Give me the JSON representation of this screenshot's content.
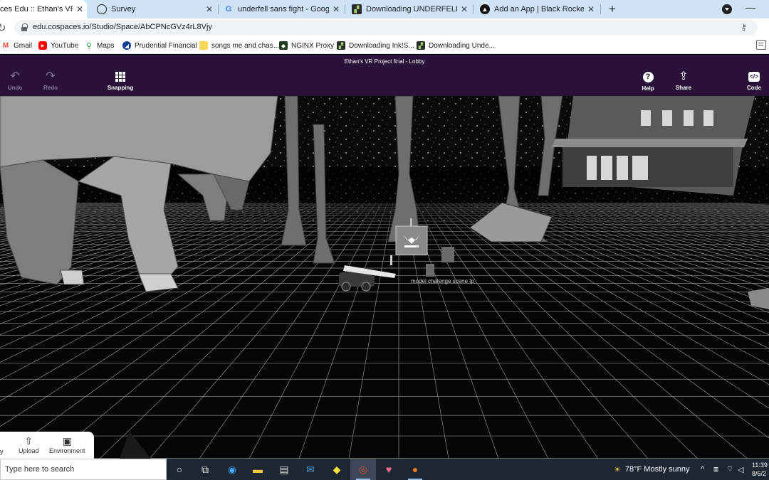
{
  "browser": {
    "tabs": [
      {
        "title": "ces Edu :: Ethan's VR Proje",
        "icon": "cospaces-icon",
        "active": true
      },
      {
        "title": "Survey",
        "icon": "survey-icon",
        "active": false
      },
      {
        "title": "underfell sans fight - Google Sea",
        "icon": "google-icon",
        "active": false
      },
      {
        "title": "Downloading UNDERFELL Sans F",
        "icon": "download-site-icon",
        "active": false
      },
      {
        "title": "Add an App | Black Rocket Arcad",
        "icon": "black-rocket-icon",
        "active": false
      }
    ],
    "close_glyph": "✕",
    "new_tab_glyph": "+",
    "minimize_glyph": "—",
    "url": "edu.cospaces.io/Studio/Space/AbCPNcGVz4rL8Vjy",
    "bookmarks": [
      {
        "label": "Gmail",
        "icon": "gmail-icon",
        "color": "#ea4335"
      },
      {
        "label": "YouTube",
        "icon": "youtube-icon",
        "color": "#ff0000"
      },
      {
        "label": "Maps",
        "icon": "maps-pin-icon",
        "color": "#34a853"
      },
      {
        "label": "Prudential Financial",
        "icon": "prudential-icon",
        "color": "#0b3d91"
      },
      {
        "label": "songs me and chas...",
        "icon": "folder-note-icon",
        "color": "#f9d65c"
      },
      {
        "label": "NGINX Proxy",
        "icon": "nginx-cat-icon",
        "color": "#2f6b2f"
      },
      {
        "label": "Downloading Ink!S...",
        "icon": "download-site-icon",
        "color": "#4a7a2b"
      },
      {
        "label": "Downloading Unde...",
        "icon": "download-site-icon",
        "color": "#4a7a2b"
      }
    ]
  },
  "cospaces": {
    "title": "Ethan's VR Project final - Lobby",
    "undo": "Undo",
    "redo": "Redo",
    "snapping": "Snapping",
    "help": "Help",
    "share": "Share",
    "code": "Code",
    "code_glyph": "</>",
    "help_glyph": "?",
    "scene_label": "model chalenge scene tp",
    "bottom": {
      "cut_label": "y",
      "upload": "Upload",
      "environment": "Environment"
    }
  },
  "taskbar": {
    "search_placeholder": "Type here to search",
    "weather": "78°F  Mostly sunny",
    "time": "11:39",
    "date": "8/6/2"
  }
}
